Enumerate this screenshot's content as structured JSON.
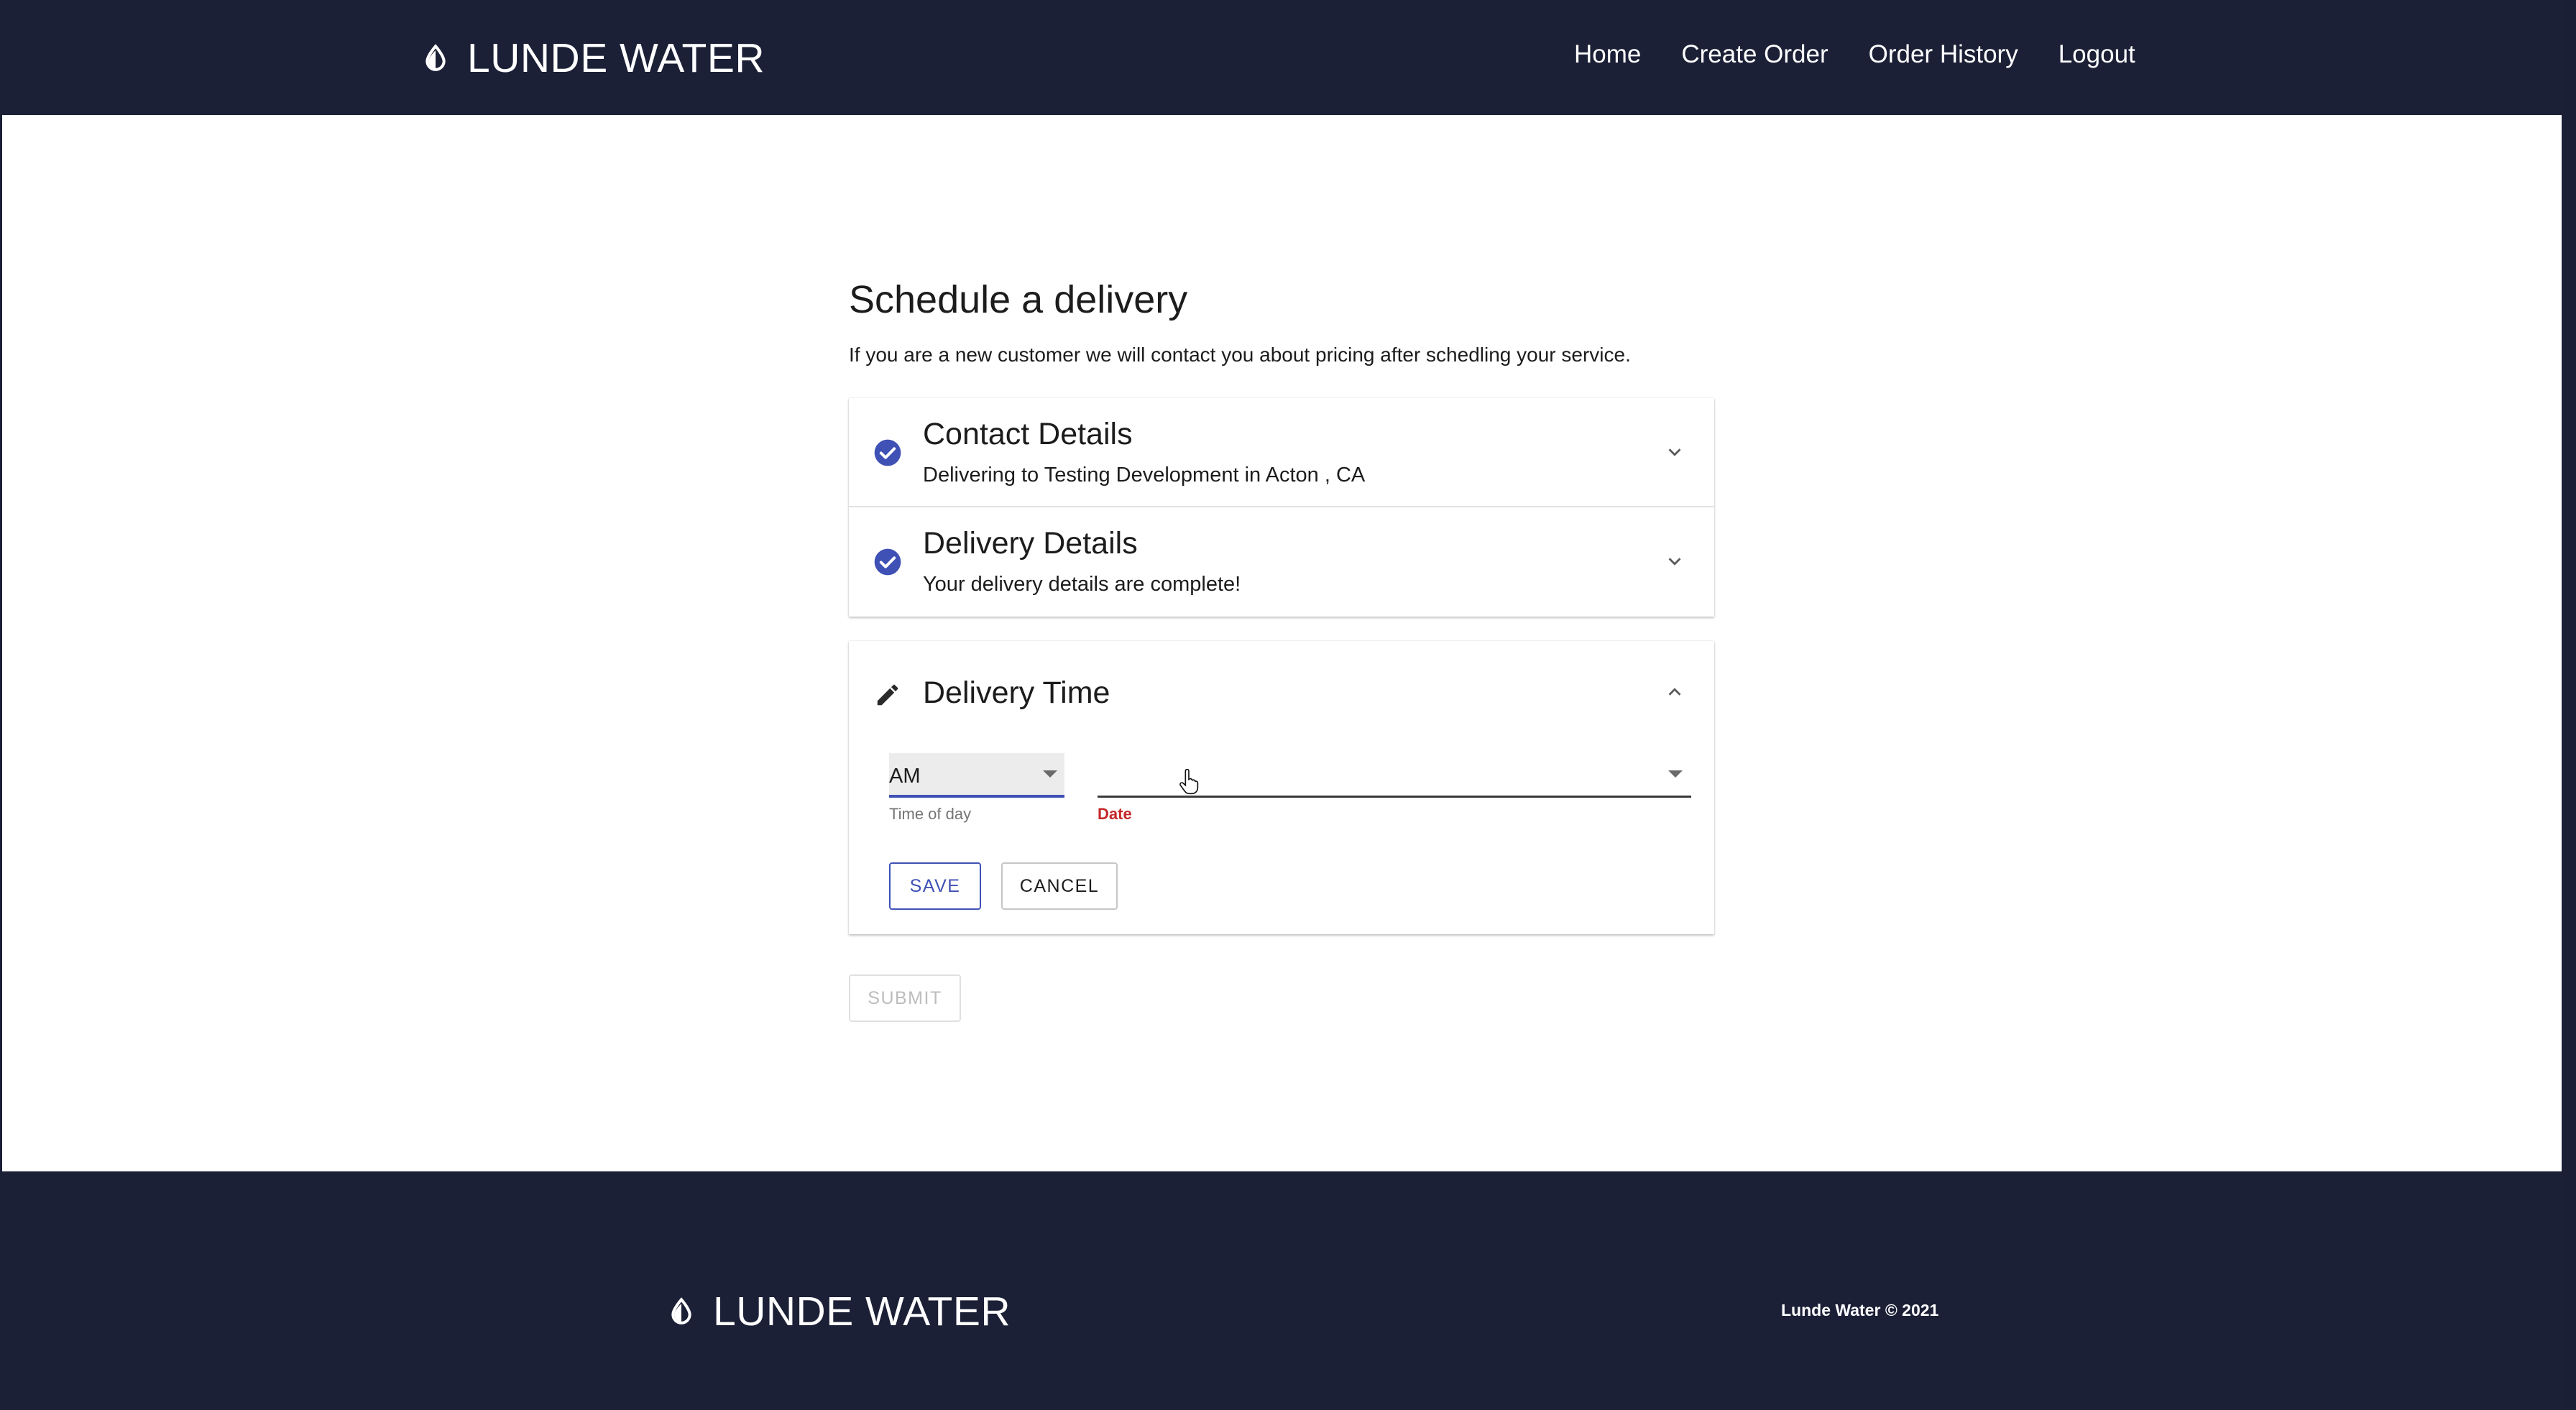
{
  "header": {
    "brand": "LUNDE WATER",
    "nav": [
      "Home",
      "Create Order",
      "Order History",
      "Logout"
    ]
  },
  "main": {
    "title": "Schedule a delivery",
    "subtitle": "If you are a new customer we will contact you about pricing after schedling your service.",
    "contact": {
      "title": "Contact Details",
      "summary": "Delivering to Testing Development in Acton , CA"
    },
    "delivery": {
      "title": "Delivery Details",
      "summary": "Your delivery details are complete!"
    },
    "delivery_time": {
      "title": "Delivery Time",
      "time_of_day_value": "AM",
      "time_of_day_label": "Time of day",
      "date_value": "",
      "date_label": "Date",
      "save_label": "SAVE",
      "cancel_label": "CANCEL"
    },
    "submit_label": "SUBMIT"
  },
  "footer": {
    "brand": "LUNDE WATER",
    "copyright": "Lunde Water © 2021"
  },
  "colors": {
    "navy": "#1b2036",
    "accent": "#3f51b5",
    "error": "#c62828"
  }
}
